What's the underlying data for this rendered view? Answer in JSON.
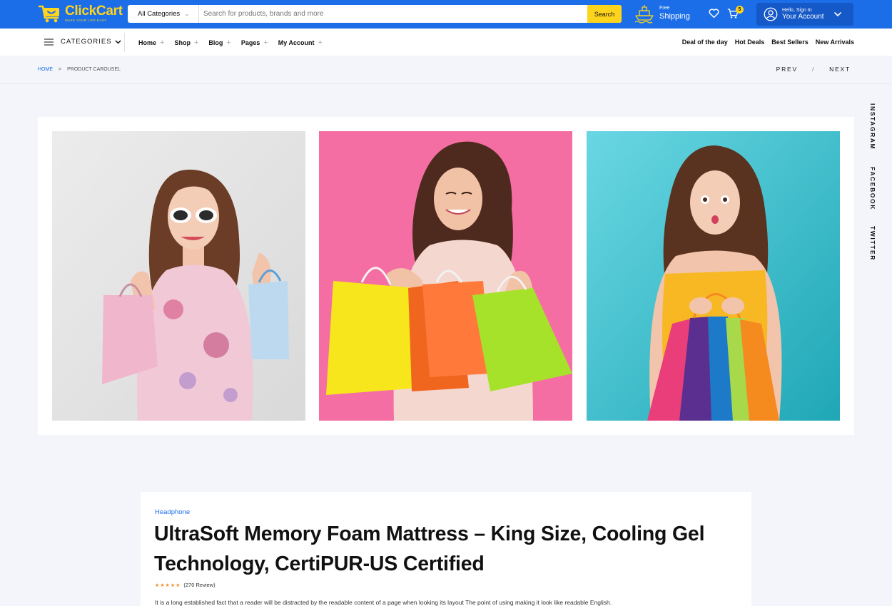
{
  "header": {
    "logo_name": "ClickCart",
    "logo_tagline": "MAKE YOUR LIFE EASY",
    "category_select": "All Categories",
    "search_placeholder": "Search for products, brands and more",
    "search_button": "Search",
    "shipping_line1": "Free",
    "shipping_line2": "Shipping",
    "cart_count": "5",
    "account_line1": "Hello, Sign In",
    "account_line2": "Your Account"
  },
  "nav": {
    "categories_label": "CATEGORIES",
    "menu": [
      "Home",
      "Shop",
      "Blog",
      "Pages",
      "My Account"
    ],
    "right_links": [
      "Deal of the day",
      "Hot Deals",
      "Best Sellers",
      "New Arrivals"
    ]
  },
  "breadcrumb": {
    "home": "HOME",
    "separator": ">",
    "current": "PRODUCT CAROUSEL",
    "prev": "PREV",
    "divider": "/",
    "next": "NEXT"
  },
  "social": [
    "INSTAGRAM",
    "FACEBOOK",
    "TWITTER"
  ],
  "carousel": {
    "slides": [
      {
        "bg": "#e6e6e6",
        "dress": "#f1c9d6",
        "bag_left": "#f0b6cc",
        "bag_right": "#bcd9f0"
      },
      {
        "bg": "#f46ea3",
        "dress": "#f4d7cf",
        "bag_left": "#f7e61c",
        "bag_right": "#a7e22a"
      },
      {
        "bg": "#5fcfdc",
        "dress": "#f7b824",
        "bag_left": "#e93e7a",
        "bag_right": "#f58a1f"
      }
    ]
  },
  "product": {
    "category": "Headphone",
    "title": "UltraSoft Memory Foam Mattress – King Size, Cooling Gel Technology, CertiPUR-US Certified",
    "stars": "★★★★★",
    "reviews": "(270 Review)",
    "description": "It is a long established fact that a reader will be distracted by the readable content of a page when looking its layout The point of using making it look like readable English."
  },
  "colors": {
    "brand_blue": "#1b6ee8",
    "accent_yellow": "#ffd41d",
    "star_orange": "#f28c28"
  }
}
